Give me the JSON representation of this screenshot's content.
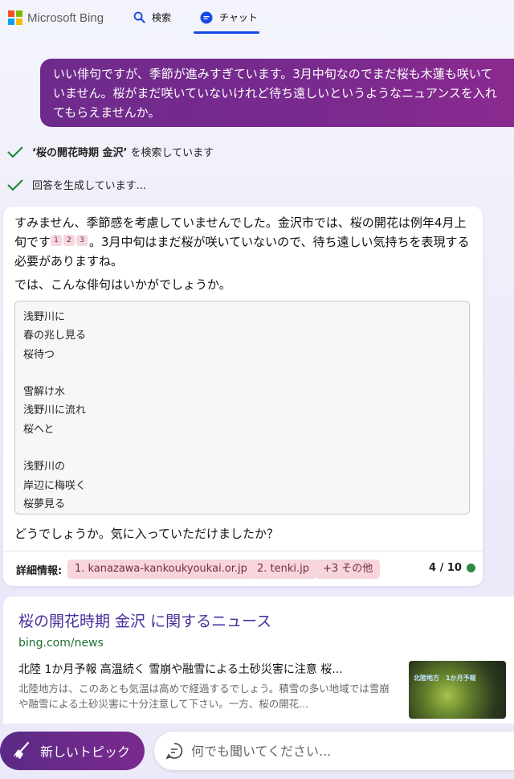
{
  "header": {
    "logo_text": "Microsoft Bing",
    "logo_colors": [
      "#f25022",
      "#7fba00",
      "#00a4ef",
      "#ffb900"
    ],
    "tabs": [
      {
        "label": "検索",
        "icon": "search-icon"
      },
      {
        "label": "チャット",
        "icon": "chat-icon",
        "active": true
      }
    ],
    "accent_color": "#174ae4"
  },
  "user_message": "いい俳句ですが、季節が進みすぎています。3月中旬なのでまだ桜も木蓮も咲いていません。桜がまだ咲いていないけれど待ち遠しいというようなニュアンスを入れてもらえませんか。",
  "status": {
    "search_query": "‘桜の開花時期 金沢’",
    "search_suffix": " を検索しています",
    "generating": "回答を生成しています..."
  },
  "answer": {
    "para1_a": "すみません、季節感を考慮していませんでした。金沢市では、桜の開花は例年4月上旬です",
    "citations": [
      "1",
      "2",
      "3"
    ],
    "para1_b": "。3月中旬はまだ桜が咲いていないので、待ち遠しい気持ちを表現する必要がありますね。",
    "para2": "では、こんな俳句はいかがでしょうか。",
    "poem_lines": [
      "浅野川に",
      "春の兆し見る",
      "桜待つ",
      "",
      "雪解け水",
      "浅野川に流れ",
      "桜へと",
      "",
      "浅野川の",
      "岸辺に梅咲く",
      "桜夢見る"
    ],
    "closing": "どうでしょうか。気に入っていただけましたか？",
    "more_info_label": "詳細情報:",
    "sources": [
      "1. kanazawa-kankoukyoukai.or.jp",
      "2. tenki.jp",
      "+3 その他"
    ],
    "counter": "4 / 10",
    "counter_color": "#2e8b3e"
  },
  "news": {
    "title": "桜の開花時期 金沢 に関するニュース",
    "url": "bing.com/news",
    "headline": "北陸 1か月予報 高温続く 雪崩や融雪による土砂災害に注意 桜...",
    "snippet": "北陸地方は、このあとも気温は高めで経過するでしょう。積雪の多い地域では雪崩や融雪による土砂災害に十分注意して下さい。一方、桜の開花...",
    "thumb_text": "北陸地方　1か月予報"
  },
  "bottom": {
    "new_topic_label": "新しいトピック",
    "ask_placeholder": "何でも聞いてください..."
  }
}
